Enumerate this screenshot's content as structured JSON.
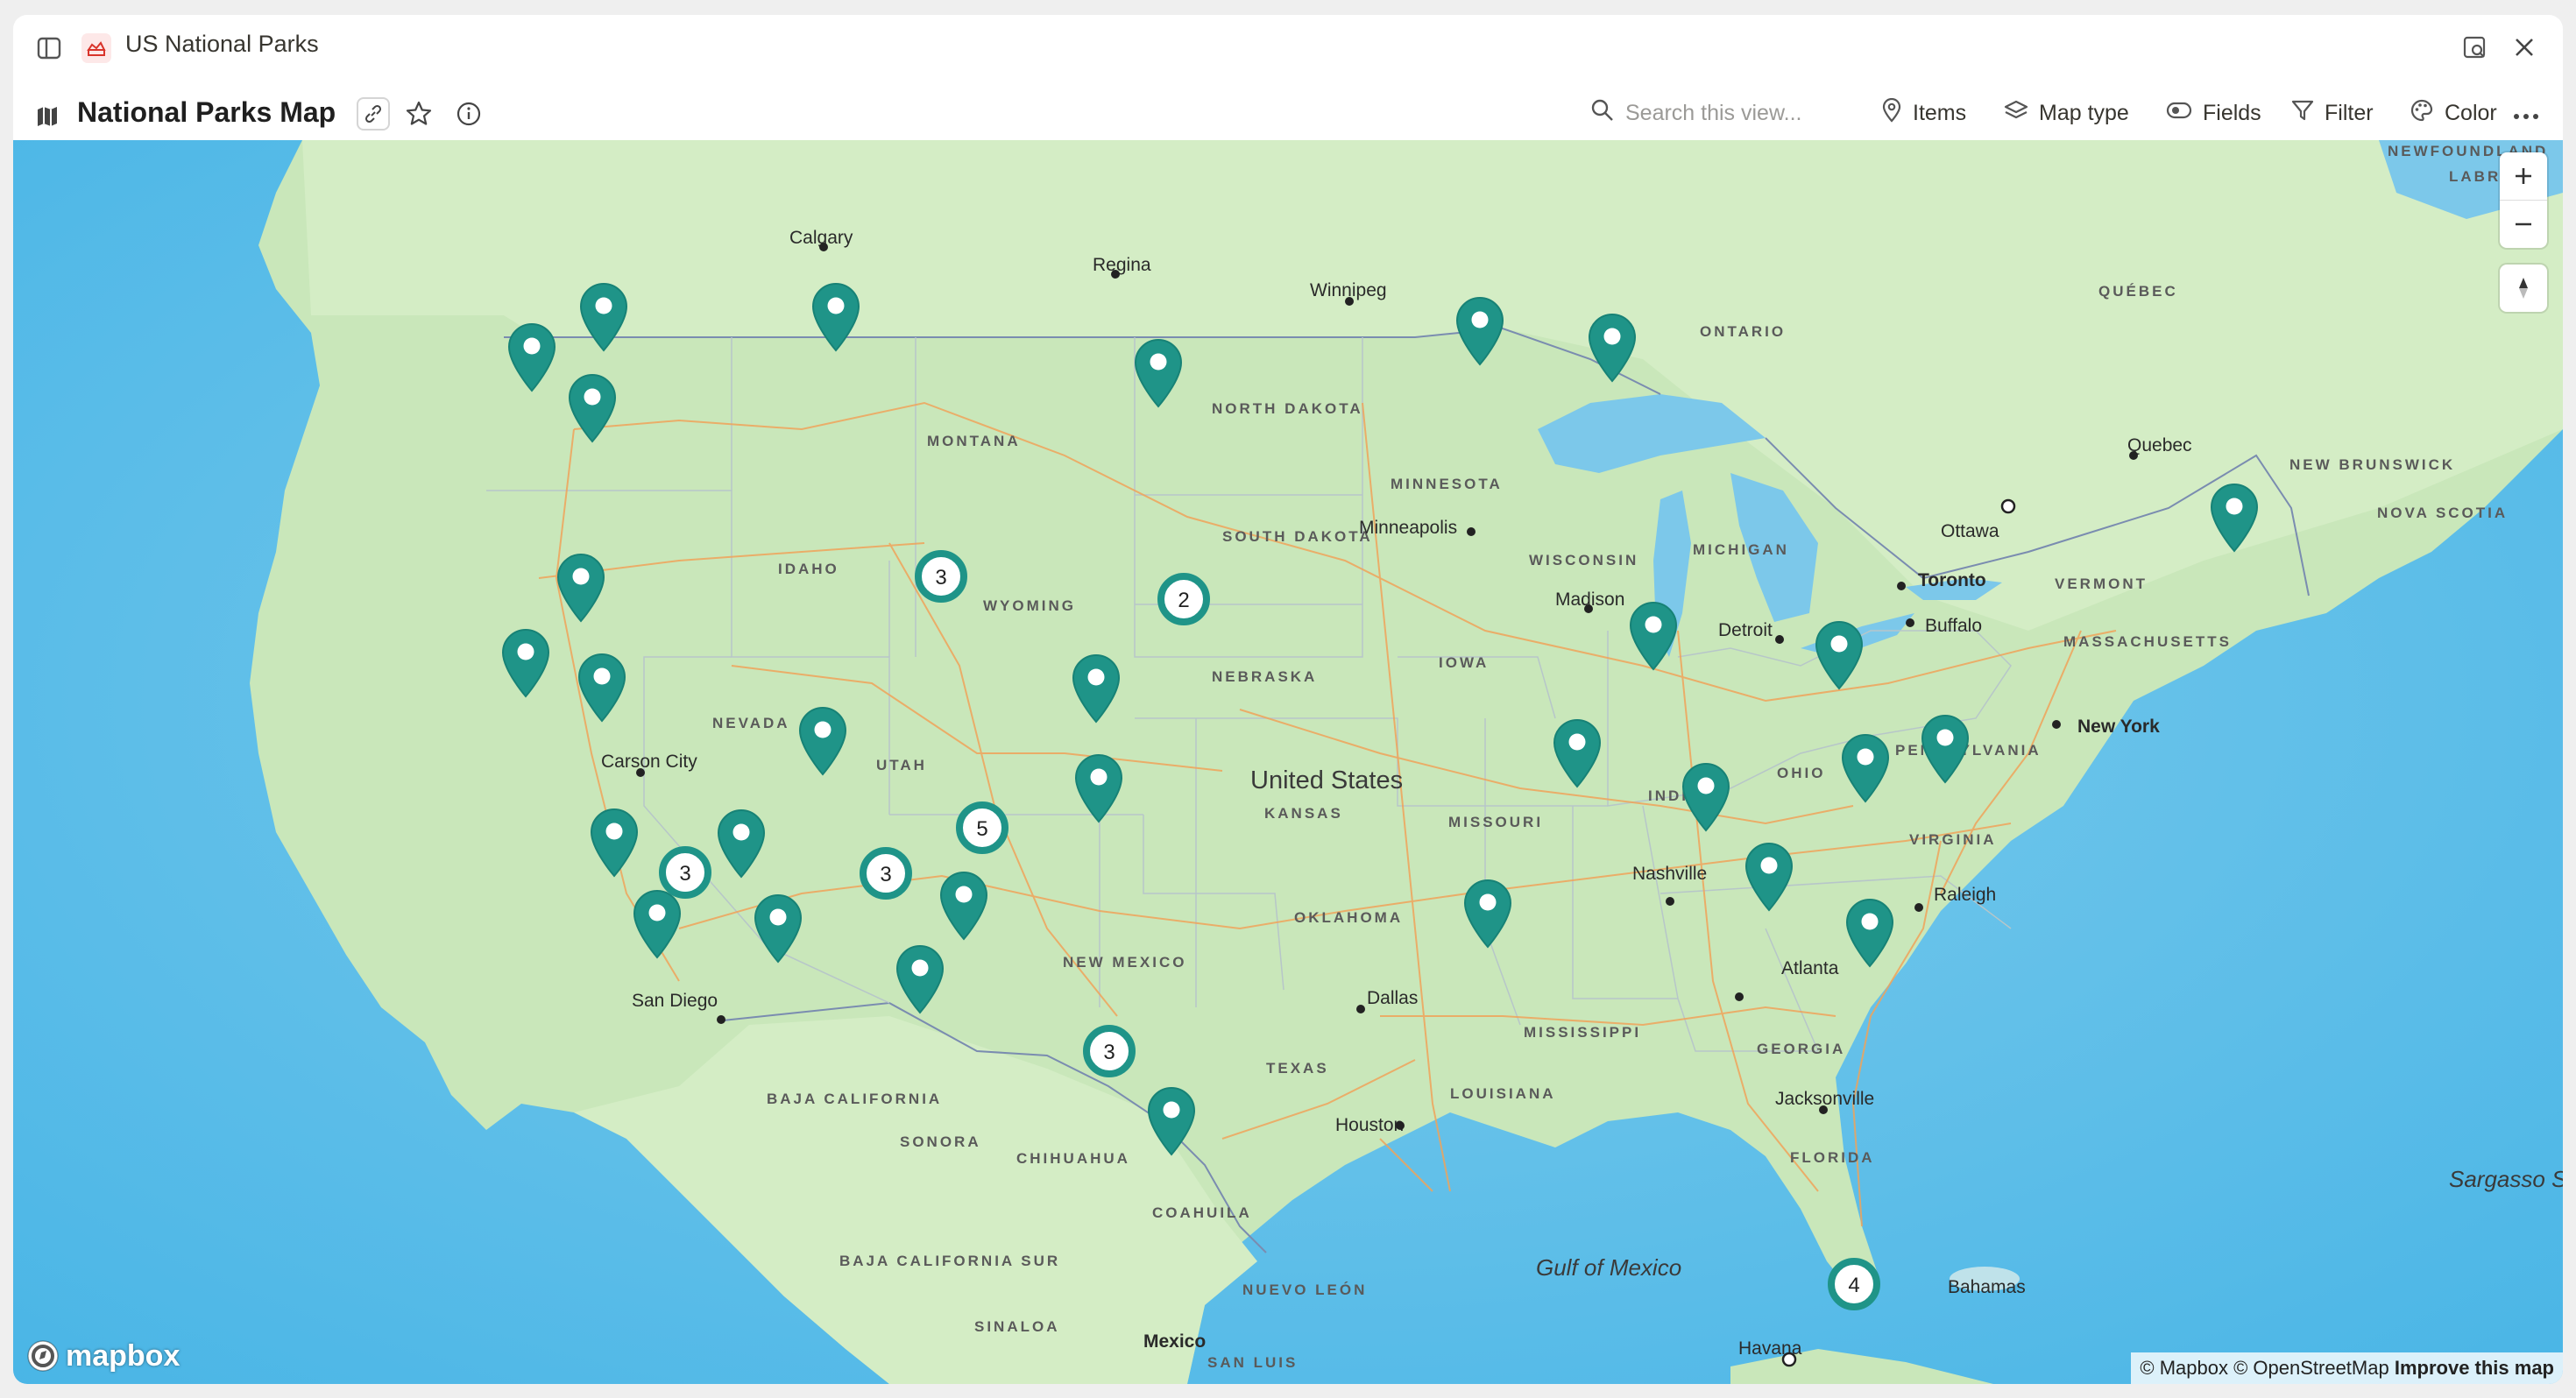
{
  "window": {
    "title": "US National Parks"
  },
  "view": {
    "title": "National Parks Map"
  },
  "toolbar": {
    "search_placeholder": "Search this view...",
    "items": "Items",
    "map_type": "Map type",
    "fields": "Fields",
    "filter": "Filter",
    "color": "Color"
  },
  "map": {
    "pin_color": "#1f9488",
    "country_label": "United States",
    "clusters": [
      "3",
      "2",
      "3",
      "5",
      "3",
      "3",
      "4"
    ],
    "state_labels": [
      "MONTANA",
      "NORTH DAKOTA",
      "SOUTH DAKOTA",
      "WYOMING",
      "IDAHO",
      "NEBRASKA",
      "NEVADA",
      "UTAH",
      "KANSAS",
      "MISSOURI",
      "OKLAHOMA",
      "NEW MEXICO",
      "TEXAS",
      "LOUISIANA",
      "MISSISSIPPI",
      "GEORGIA",
      "FLORIDA",
      "INDIANA",
      "OHIO",
      "PENNSYLVANIA",
      "VIRGINIA",
      "MICHIGAN",
      "WISCONSIN",
      "MINNESOTA",
      "IOWA",
      "VERMONT",
      "MASSACHUSETTS",
      "ONTARIO",
      "QUÉBEC",
      "NEW BRUNSWICK",
      "NOVA SCOTIA",
      "BAJA CALIFORNIA",
      "SONORA",
      "CHIHUAHUA",
      "COAHUILA",
      "BAJA CALIFORNIA SUR",
      "SINALOA",
      "NUEVO LEÓN",
      "SAN LUIS",
      "NEWFOUNDLAND",
      "LABR"
    ],
    "city_labels": [
      "Calgary",
      "Regina",
      "Winnipeg",
      "Minneapolis",
      "Madison",
      "Detroit",
      "Toronto",
      "Buffalo",
      "Ottawa",
      "Quebec",
      "New York",
      "Carson City",
      "San Diego",
      "Dallas",
      "Houston",
      "Nashville",
      "Atlanta",
      "Raleigh",
      "Jacksonville",
      "Havana",
      "Mexico",
      "Bahamas"
    ],
    "water_labels": [
      "Gulf of Mexico",
      "Sargasso Sea"
    ],
    "logo": "mapbox",
    "attribution": "© Mapbox © OpenStreetMap",
    "improve": "Improve this map"
  }
}
